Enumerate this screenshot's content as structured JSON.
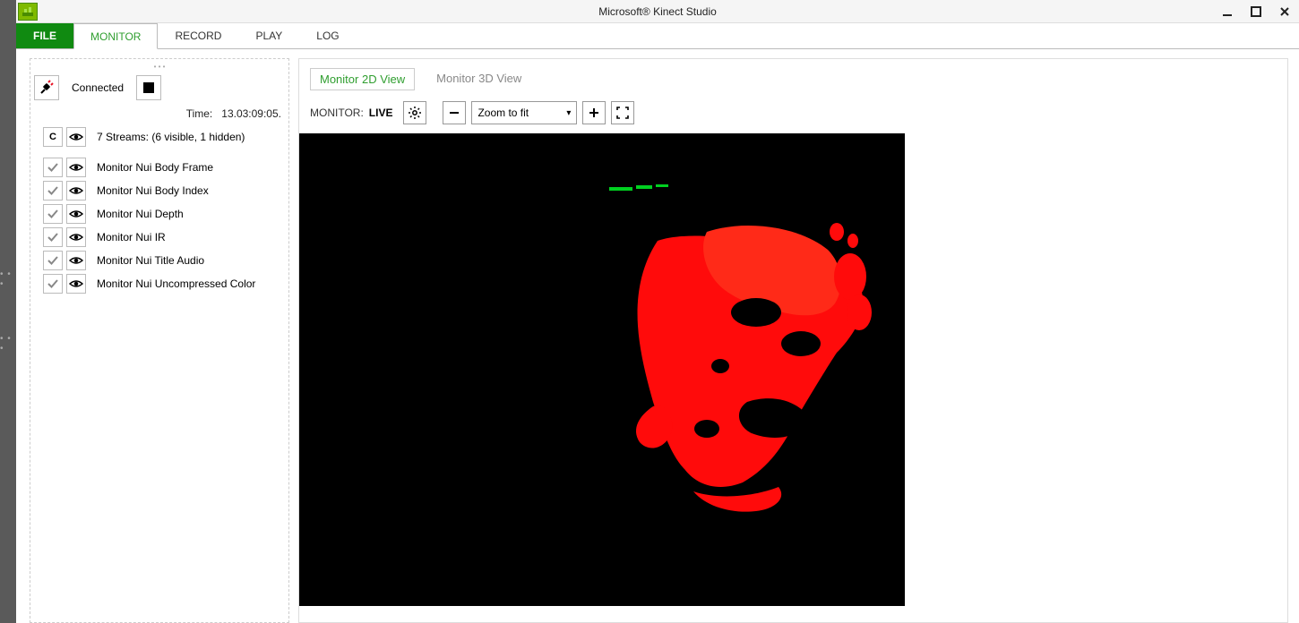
{
  "title": "Microsoft® Kinect Studio",
  "menu": {
    "file": "FILE",
    "monitor": "MONITOR",
    "record": "RECORD",
    "play": "PLAY",
    "log": "LOG"
  },
  "connection": {
    "status": "Connected"
  },
  "time": {
    "label": "Time:",
    "value": "13.03:09:05."
  },
  "streamsHeader": {
    "c": "C",
    "summary": "7 Streams: (6 visible, 1 hidden)"
  },
  "streams": [
    {
      "name": "Monitor Nui Body Frame"
    },
    {
      "name": "Monitor Nui Body Index"
    },
    {
      "name": "Monitor Nui Depth"
    },
    {
      "name": "Monitor Nui IR"
    },
    {
      "name": "Monitor Nui Title Audio"
    },
    {
      "name": "Monitor Nui Uncompressed Color"
    }
  ],
  "viewTabs": {
    "t2d": "Monitor 2D View",
    "t3d": "Monitor 3D View"
  },
  "monitorBar": {
    "label": "MONITOR:",
    "status": "LIVE",
    "zoom": "Zoom to fit"
  }
}
